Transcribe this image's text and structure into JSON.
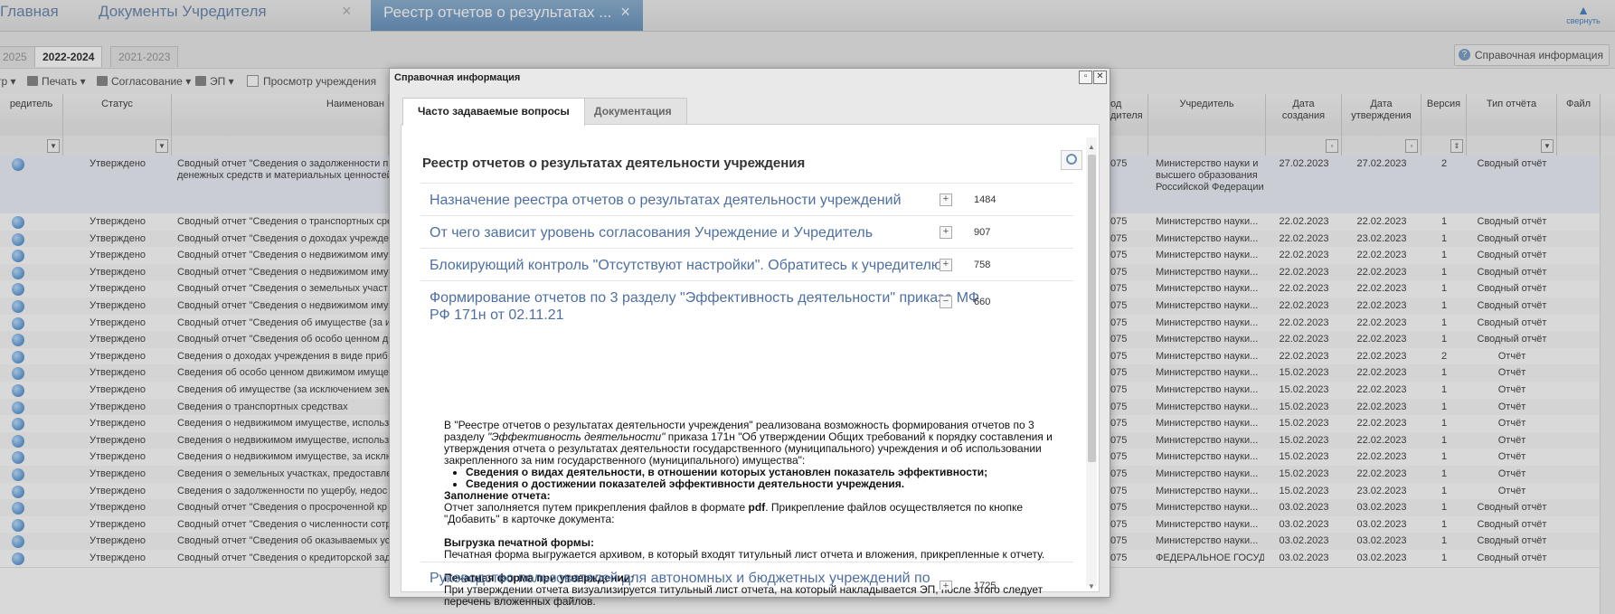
{
  "top_tabs": {
    "home": "Главная",
    "docs": "Документы Учредителя",
    "active": "Реестр отчетов о результатах ...",
    "close_glyph": "×",
    "collapse": "свернуть"
  },
  "year_tabs": [
    "2025",
    "2022-2024",
    "2021-2023"
  ],
  "help_button": "Справочная информация",
  "toolbar": {
    "items": [
      "тр ▾",
      "Печать ▾",
      "Согласование ▾",
      "ЭП ▾"
    ],
    "view_checkbox": "Просмотр учреждения"
  },
  "grid": {
    "headers": {
      "founder": "редитель",
      "status": "Статус",
      "name": "Наименован",
      "code": "од\nдителя",
      "uchreditel": "Учредитель",
      "created": "Дата\nсоздания",
      "approved": "Дата\nутверждения",
      "version": "Версия",
      "type": "Тип отчёта",
      "file": "Файл"
    },
    "rows": [
      {
        "status": "Утверждено",
        "name": "Сводный отчет \"Сведения о задолженности п денежных средств и материальных ценностей",
        "code": "075",
        "uchr": "Министерство науки и высшего образования Российской Федерации",
        "created": "27.02.2023",
        "approved": "27.02.2023",
        "version": "2",
        "type": "Сводный отчёт"
      },
      {
        "status": "Утверждено",
        "name": "Сводный отчет \"Сведения о транспортных сре",
        "code": "075",
        "uchr": "Министерство науки...",
        "created": "22.02.2023",
        "approved": "22.02.2023",
        "version": "1",
        "type": "Сводный отчёт"
      },
      {
        "status": "Утверждено",
        "name": "Сводный отчет \"Сведения о доходах учрежде",
        "code": "075",
        "uchr": "Министерство науки...",
        "created": "22.02.2023",
        "approved": "23.02.2023",
        "version": "1",
        "type": "Сводный отчёт"
      },
      {
        "status": "Утверждено",
        "name": "Сводный отчет \"Сведения о недвижимом иму",
        "code": "075",
        "uchr": "Министерство науки...",
        "created": "22.02.2023",
        "approved": "22.02.2023",
        "version": "1",
        "type": "Сводный отчёт"
      },
      {
        "status": "Утверждено",
        "name": "Сводный отчет \"Сведения о недвижимом иму",
        "code": "075",
        "uchr": "Министерство науки...",
        "created": "22.02.2023",
        "approved": "22.02.2023",
        "version": "1",
        "type": "Сводный отчёт"
      },
      {
        "status": "Утверждено",
        "name": "Сводный отчет \"Сведения о земельных участ",
        "code": "075",
        "uchr": "Министерство науки...",
        "created": "22.02.2023",
        "approved": "22.02.2023",
        "version": "1",
        "type": "Сводный отчёт"
      },
      {
        "status": "Утверждено",
        "name": "Сводный отчет \"Сведения о недвижимом иму",
        "code": "075",
        "uchr": "Министерство науки...",
        "created": "22.02.2023",
        "approved": "22.02.2023",
        "version": "1",
        "type": "Сводный отчёт"
      },
      {
        "status": "Утверждено",
        "name": "Сводный отчет \"Сведения об имуществе (за и",
        "code": "075",
        "uchr": "Министерство науки...",
        "created": "22.02.2023",
        "approved": "22.02.2023",
        "version": "1",
        "type": "Сводный отчёт"
      },
      {
        "status": "Утверждено",
        "name": "Сводный отчет \"Сведения об особо ценном д",
        "code": "075",
        "uchr": "Министерство науки...",
        "created": "22.02.2023",
        "approved": "22.02.2023",
        "version": "1",
        "type": "Сводный отчёт"
      },
      {
        "status": "Утверждено",
        "name": "Сведения о доходах учреждения в виде приб",
        "code": "075",
        "uchr": "Министерство науки...",
        "created": "22.02.2023",
        "approved": "22.02.2023",
        "version": "2",
        "type": "Отчёт"
      },
      {
        "status": "Утверждено",
        "name": "Сведения об особо ценном движимом имущес",
        "code": "075",
        "uchr": "Министерство науки...",
        "created": "15.02.2023",
        "approved": "22.02.2023",
        "version": "1",
        "type": "Отчёт"
      },
      {
        "status": "Утверждено",
        "name": "Сведения об имуществе (за исключением зем",
        "code": "075",
        "uchr": "Министерство науки...",
        "created": "15.02.2023",
        "approved": "22.02.2023",
        "version": "1",
        "type": "Отчёт"
      },
      {
        "status": "Утверждено",
        "name": "Сведения о транспортных средствах",
        "code": "075",
        "uchr": "Министерство науки...",
        "created": "15.02.2023",
        "approved": "22.02.2023",
        "version": "1",
        "type": "Отчёт"
      },
      {
        "status": "Утверждено",
        "name": "Сведения о недвижимом имуществе, использу",
        "code": "075",
        "uchr": "Министерство науки...",
        "created": "15.02.2023",
        "approved": "22.02.2023",
        "version": "1",
        "type": "Отчёт"
      },
      {
        "status": "Утверждено",
        "name": "Сведения о недвижимом имуществе, использу",
        "code": "075",
        "uchr": "Министерство науки...",
        "created": "15.02.2023",
        "approved": "22.02.2023",
        "version": "1",
        "type": "Отчёт"
      },
      {
        "status": "Утверждено",
        "name": "Сведения о недвижимом имуществе, за исклю",
        "code": "075",
        "uchr": "Министерство науки...",
        "created": "15.02.2023",
        "approved": "22.02.2023",
        "version": "1",
        "type": "Отчёт"
      },
      {
        "status": "Утверждено",
        "name": "Сведения о земельных участках, предоставле",
        "code": "075",
        "uchr": "Министерство науки...",
        "created": "15.02.2023",
        "approved": "22.02.2023",
        "version": "1",
        "type": "Отчёт"
      },
      {
        "status": "Утверждено",
        "name": "Сведения о задолженности по ущербу, недос",
        "code": "075",
        "uchr": "Министерство науки...",
        "created": "15.02.2023",
        "approved": "23.02.2023",
        "version": "1",
        "type": "Отчёт"
      },
      {
        "status": "Утверждено",
        "name": "Сводный отчет \"Сведения о просроченной кр",
        "code": "075",
        "uchr": "Министерство науки...",
        "created": "03.02.2023",
        "approved": "03.02.2023",
        "version": "1",
        "type": "Сводный отчёт"
      },
      {
        "status": "Утверждено",
        "name": "Сводный отчет \"Сведения о численности сотр",
        "code": "075",
        "uchr": "Министерство науки...",
        "created": "03.02.2023",
        "approved": "03.02.2023",
        "version": "1",
        "type": "Сводный отчёт"
      },
      {
        "status": "Утверждено",
        "name": "Сводный отчет \"Сведения об оказываемых ус",
        "code": "075",
        "uchr": "Министерство науки...",
        "created": "03.02.2023",
        "approved": "03.02.2023",
        "version": "1",
        "type": "Сводный отчёт"
      },
      {
        "status": "Утверждено",
        "name": "Сводный отчет \"Сведения о кредиторской задолженности и обязательствах учрежде...",
        "code": "075",
        "uchr": "ФЕДЕРАЛЬНОЕ ГОСУДАРСТВЕННОЕ",
        "created": "03.02.2023",
        "approved": "03.02.2023",
        "version": "1",
        "type": "Сводный отчёт"
      }
    ]
  },
  "modal": {
    "title": "Справочная информация",
    "tabs": [
      "Часто задаваемые вопросы",
      "Документация"
    ],
    "section_title": "Реестр отчетов о результатах деятельности учреждения",
    "faq": [
      {
        "q": "Назначение реестра отчетов о результатах деятельности учреждений",
        "count": "1484",
        "sign": "+"
      },
      {
        "q": "От чего зависит уровень согласования Учреждение и Учредитель",
        "count": "907",
        "sign": "+"
      },
      {
        "q": "Блокирующий контроль \"Отсутствуют настройки\". Обратитесь к учредителю",
        "count": "758",
        "sign": "+"
      },
      {
        "q": "Формирование отчетов по 3 разделу \"Эффективность деятельности\" приказа МФ РФ 171н от 02.11.21",
        "count": "660",
        "sign": "−"
      },
      {
        "q": "Руководство пользователей для автономных и бюджетных учреждений по",
        "count": "1725",
        "sign": "+"
      }
    ],
    "answer": {
      "p1_a": "В \"Реестре отчетов о результатах деятельности учреждения\" реализована возможность формирования отчетов по 3 разделу ",
      "p1_i": "\"Эффективность деятельности\"",
      "p1_b": " приказа 171н \"Об утверждении Общих требований к порядку составления и утверждения отчета о результатах деятельности государственного (муниципального) учреждения и об использовании закрепленного за ним государственного (муниципального) имущества\":",
      "bullets": [
        "Сведения о видах деятельности, в отношении которых установлен показатель эффективности;",
        "Сведения о достижении показателей эффективности деятельности учреждения."
      ],
      "fill_title": "Заполнение отчета:",
      "fill_a": "Отчет заполняется путем прикрепления файлов в формате ",
      "fill_pdf": "pdf",
      "fill_b": ". Прикрепление файлов осуществляется по кнопке \"Добавить\" в карточке документа:",
      "print_title": "Выгрузка печатной формы:",
      "print_text": "Печатная форма выгружается архивом, в который входят титульный лист отчета и вложения, прикрепленные к отчету.",
      "approve_title": "Печатная форма при утверждении:",
      "approve_text": "При утверждении отчета визуализируется титульный лист отчета, на который накладывается ЭП, после этого следует перечень вложенных файлов."
    }
  }
}
